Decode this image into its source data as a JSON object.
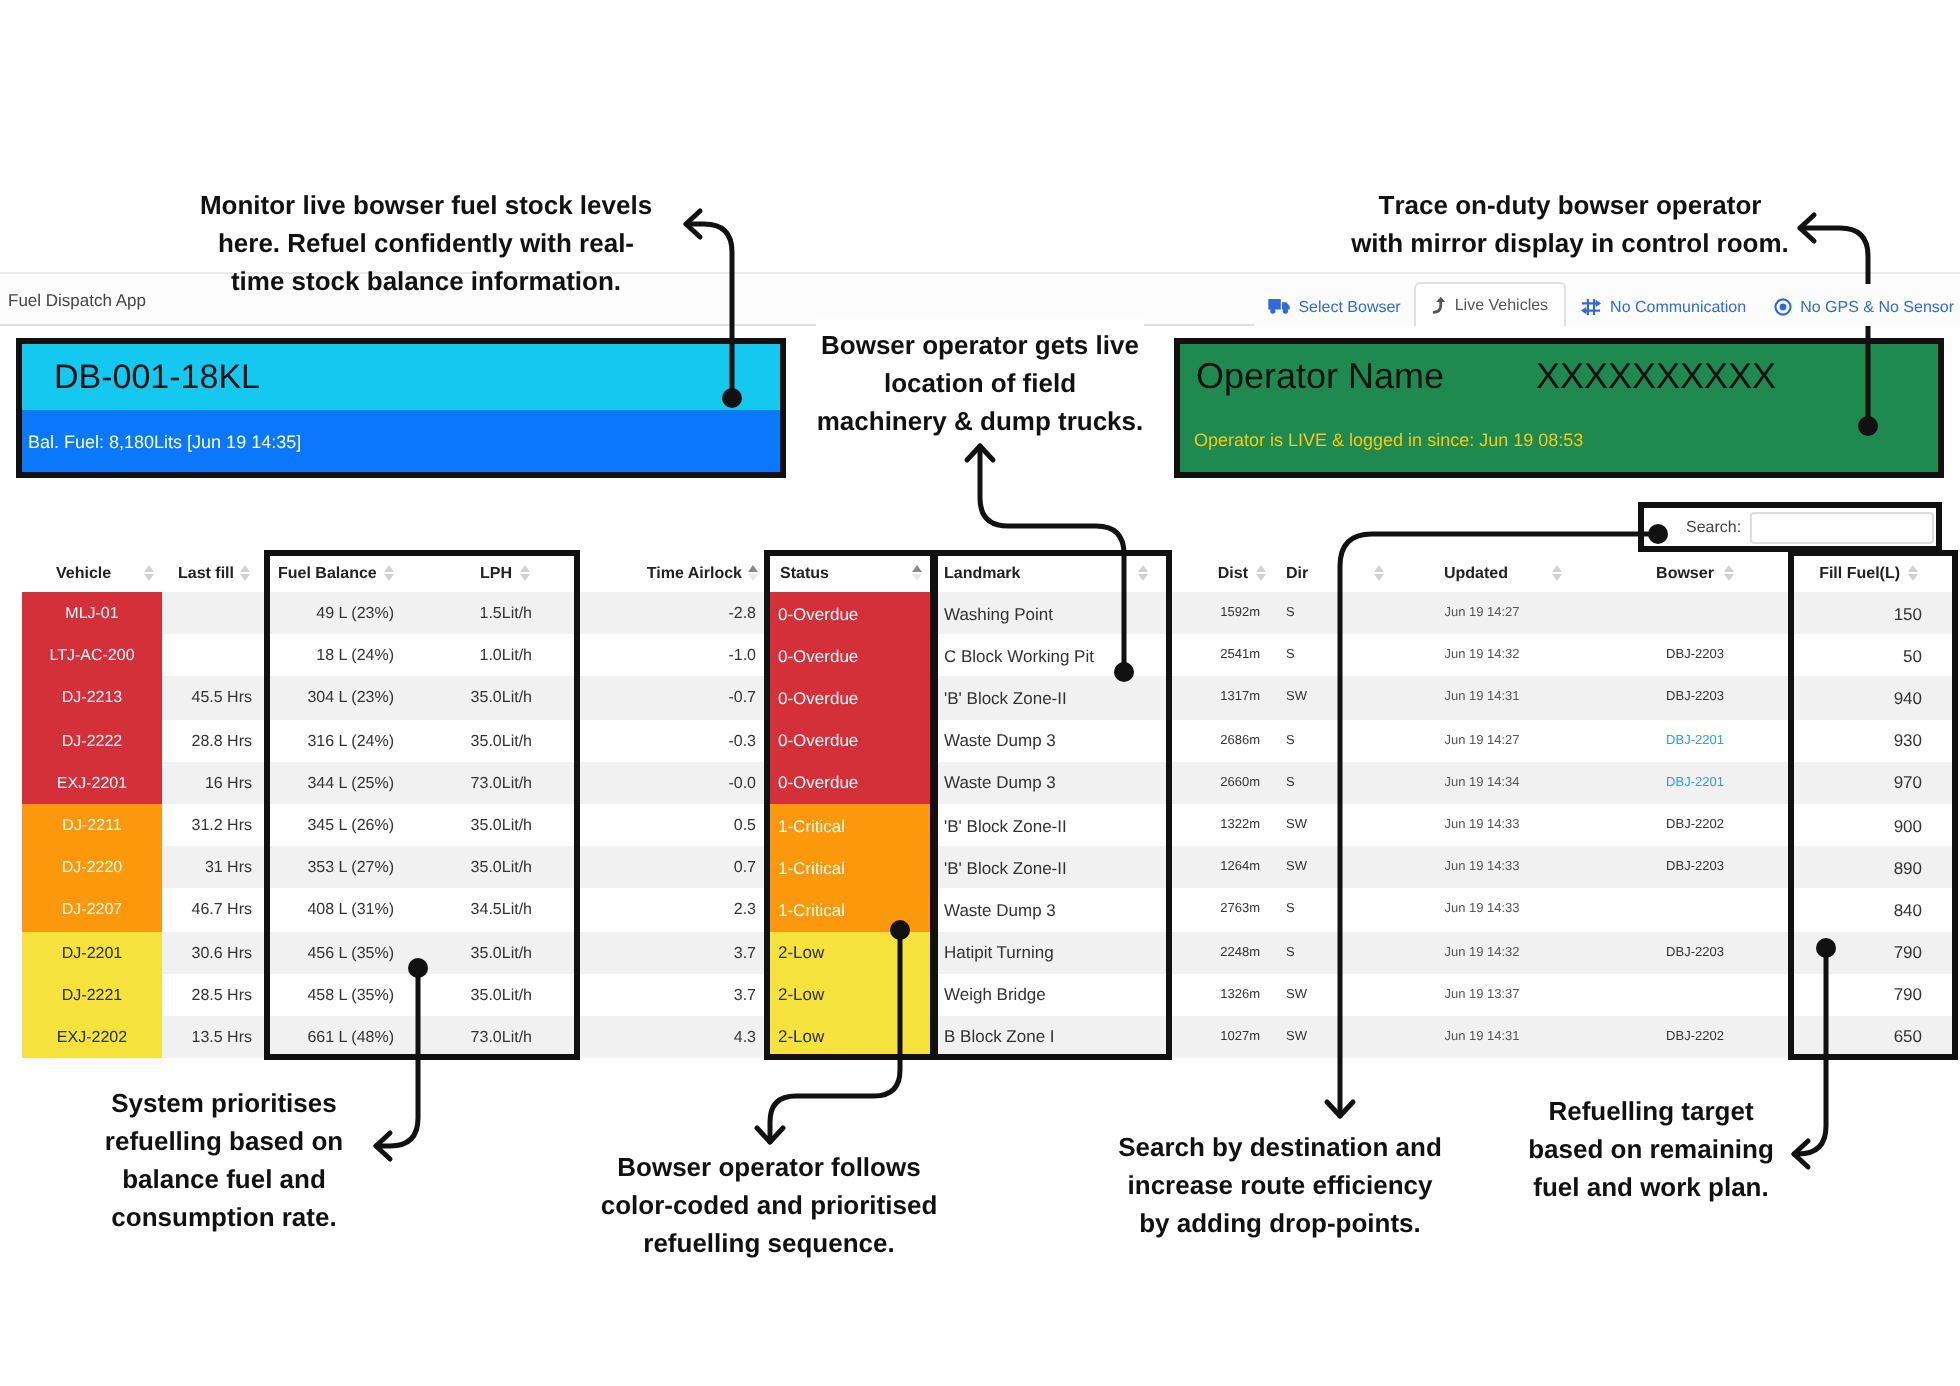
{
  "app": {
    "title": "Fuel Dispatch App"
  },
  "tabs": [
    {
      "label": "Select Bowser",
      "selected": false
    },
    {
      "label": "Live Vehicles",
      "selected": true
    },
    {
      "label": "No Communication",
      "selected": false
    },
    {
      "label": "No GPS & No Sensor",
      "selected": false
    }
  ],
  "bowser_card": {
    "id": "DB-001-18KL",
    "balance": "Bal. Fuel: 8,180Lits [Jun 19 14:35]"
  },
  "operator_card": {
    "label": "Operator Name",
    "name": "XXXXXXXXXX",
    "status": "Operator is LIVE & logged in since: Jun 19 08:53"
  },
  "search": {
    "label": "Search:"
  },
  "table": {
    "columns": [
      {
        "label": "Vehicle",
        "sorted": false
      },
      {
        "label": "Last fill",
        "sorted": false
      },
      {
        "label": "Fuel Balance",
        "sorted": false
      },
      {
        "label": "LPH",
        "sorted": false
      },
      {
        "label": "Time Airlock",
        "sorted": true
      },
      {
        "label": "Status",
        "sorted": true
      },
      {
        "label": "Landmark",
        "sorted": false
      },
      {
        "label": "Dist",
        "sorted": false
      },
      {
        "label": "Dir"
      },
      {
        "sorted": false
      },
      {
        "label": "Updated",
        "sorted": false
      },
      {
        "label": "Bowser",
        "sorted": false
      },
      {
        "label": "Fill Fuel(L)",
        "sorted": false
      }
    ],
    "rows": [
      {
        "vehicle": "MLJ-01",
        "fuel_balance": "49 L (23%)",
        "lph": "1.5Lit/h",
        "time_airlock": "-2.8",
        "status": "0-Overdue",
        "color": "#d3303a",
        "landmark": "Washing Point",
        "dist": "1592m",
        "dir": "S",
        "updated": "Jun 19 14:27",
        "fill_fuel": "150"
      },
      {
        "vehicle": "LTJ-AC-200",
        "fuel_balance": "18 L (24%)",
        "lph": "1.0Lit/h",
        "time_airlock": "-1.0",
        "status": "0-Overdue",
        "color": "#d3303a",
        "landmark": "C Block Working Pit",
        "dist": "2541m",
        "dir": "S",
        "updated": "Jun 19 14:32",
        "bowser": {
          "text": "DBJ-2203",
          "link": false
        },
        "fill_fuel": "50"
      },
      {
        "vehicle": "DJ-2213",
        "last_fill": "45.5 Hrs",
        "fuel_balance": "304 L (23%)",
        "lph": "35.0Lit/h",
        "time_airlock": "-0.7",
        "status": "0-Overdue",
        "color": "#d3303a",
        "landmark": "'B' Block Zone-II",
        "dist": "1317m",
        "dir": "SW",
        "updated": "Jun 19 14:31",
        "bowser": {
          "text": "DBJ-2203",
          "link": false
        },
        "fill_fuel": "940"
      },
      {
        "vehicle": "DJ-2222",
        "last_fill": "28.8 Hrs",
        "fuel_balance": "316 L (24%)",
        "lph": "35.0Lit/h",
        "time_airlock": "-0.3",
        "status": "0-Overdue",
        "color": "#d3303a",
        "landmark": "Waste Dump 3",
        "dist": "2686m",
        "dir": "S",
        "updated": "Jun 19 14:27",
        "bowser": {
          "text": "DBJ-2201",
          "link": true
        },
        "fill_fuel": "930"
      },
      {
        "vehicle": "EXJ-2201",
        "last_fill": "16 Hrs",
        "fuel_balance": "344 L (25%)",
        "lph": "73.0Lit/h",
        "time_airlock": "-0.0",
        "status": "0-Overdue",
        "color": "#d3303a",
        "landmark": "Waste Dump 3",
        "dist": "2660m",
        "dir": "S",
        "updated": "Jun 19 14:34",
        "bowser": {
          "text": "DBJ-2201",
          "link": true
        },
        "fill_fuel": "970"
      },
      {
        "vehicle": "DJ-2211",
        "last_fill": "31.2 Hrs",
        "fuel_balance": "345 L (26%)",
        "lph": "35.0Lit/h",
        "time_airlock": "0.5",
        "status": "1-Critical",
        "color": "#fb980c",
        "landmark": "'B' Block Zone-II",
        "dist": "1322m",
        "dir": "SW",
        "updated": "Jun 19 14:33",
        "bowser": {
          "text": "DBJ-2202",
          "link": false
        },
        "fill_fuel": "900"
      },
      {
        "vehicle": "DJ-2220",
        "last_fill": "31 Hrs",
        "fuel_balance": "353 L (27%)",
        "lph": "35.0Lit/h",
        "time_airlock": "0.7",
        "status": "1-Critical",
        "color": "#fb980c",
        "landmark": "'B' Block Zone-II",
        "dist": "1264m",
        "dir": "SW",
        "updated": "Jun 19 14:33",
        "bowser": {
          "text": "DBJ-2203",
          "link": false
        },
        "fill_fuel": "890"
      },
      {
        "vehicle": "DJ-2207",
        "last_fill": "46.7 Hrs",
        "fuel_balance": "408 L (31%)",
        "lph": "34.5Lit/h",
        "time_airlock": "2.3",
        "status": "1-Critical",
        "color": "#fb980c",
        "landmark": "Waste Dump 3",
        "dist": "2763m",
        "dir": "S",
        "updated": "Jun 19 14:33",
        "fill_fuel": "840"
      },
      {
        "vehicle": "DJ-2201",
        "last_fill": "30.6 Hrs",
        "fuel_balance": "456 L (35%)",
        "lph": "35.0Lit/h",
        "time_airlock": "3.7",
        "status": "2-Low",
        "color": "#f6e23c",
        "landmark": "Hatipit Turning",
        "dist": "2248m",
        "dir": "S",
        "updated": "Jun 19 14:32",
        "bowser": {
          "text": "DBJ-2203",
          "link": false
        },
        "fill_fuel": "790"
      },
      {
        "vehicle": "DJ-2221",
        "last_fill": "28.5 Hrs",
        "fuel_balance": "458 L (35%)",
        "lph": "35.0Lit/h",
        "time_airlock": "3.7",
        "status": "2-Low",
        "color": "#f6e23c",
        "landmark": "Weigh Bridge",
        "dist": "1326m",
        "dir": "SW",
        "updated": "Jun 19 13:37",
        "fill_fuel": "790"
      },
      {
        "vehicle": "EXJ-2202",
        "last_fill": "13.5 Hrs",
        "fuel_balance": "661 L (48%)",
        "lph": "73.0Lit/h",
        "time_airlock": "4.3",
        "status": "2-Low",
        "color": "#f6e23c",
        "landmark": "B Block Zone I",
        "dist": "1027m",
        "dir": "SW",
        "updated": "Jun 19 14:31",
        "bowser": {
          "text": "DBJ-2202",
          "link": false
        },
        "fill_fuel": "650"
      }
    ]
  },
  "callouts": [
    "Monitor live bowser fuel stock levels here. Refuel confidently with real-time stock balance information.",
    "Trace on-duty bowser operator with mirror display in control room.",
    "Bowser operator gets live location of field machinery & dump trucks.",
    "System prioritises refuelling based on balance fuel and consumption rate.",
    "Bowser operator follows color-coded and prioritised refuelling sequence.",
    "Search by destination and increase route efficiency by adding drop-points.",
    "Refuelling target based on remaining fuel and work plan."
  ]
}
